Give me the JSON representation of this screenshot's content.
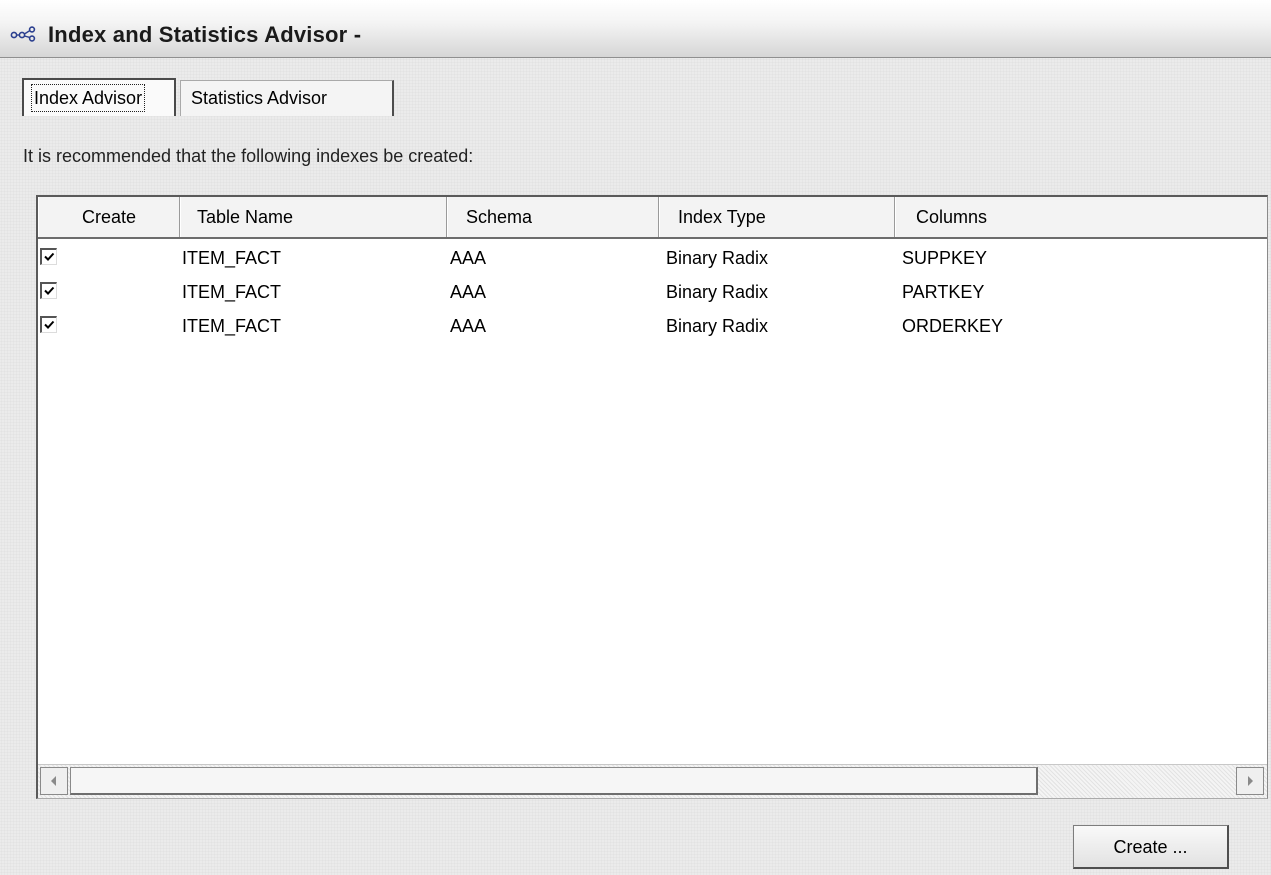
{
  "window": {
    "title": "Index and Statistics Advisor -"
  },
  "tabs": [
    {
      "label": "Index Advisor",
      "active": true
    },
    {
      "label": "Statistics Advisor",
      "active": false
    }
  ],
  "instruction": "It is recommended that the following indexes be created:",
  "table": {
    "columns": [
      "Create",
      "Table Name",
      "Schema",
      "Index Type",
      "Columns"
    ],
    "rows": [
      {
        "create": true,
        "table_name": "ITEM_FACT",
        "schema": "AAA",
        "index_type": "Binary Radix",
        "columns": "SUPPKEY"
      },
      {
        "create": true,
        "table_name": "ITEM_FACT",
        "schema": "AAA",
        "index_type": "Binary Radix",
        "columns": "PARTKEY"
      },
      {
        "create": true,
        "table_name": "ITEM_FACT",
        "schema": "AAA",
        "index_type": "Binary Radix",
        "columns": "ORDERKEY"
      }
    ]
  },
  "buttons": {
    "create_label": "Create ..."
  },
  "icons": {
    "title": "advisor-nodes-icon",
    "check": "checkmark-icon",
    "scroll_left": "arrow-left-icon",
    "scroll_right": "arrow-right-icon"
  }
}
